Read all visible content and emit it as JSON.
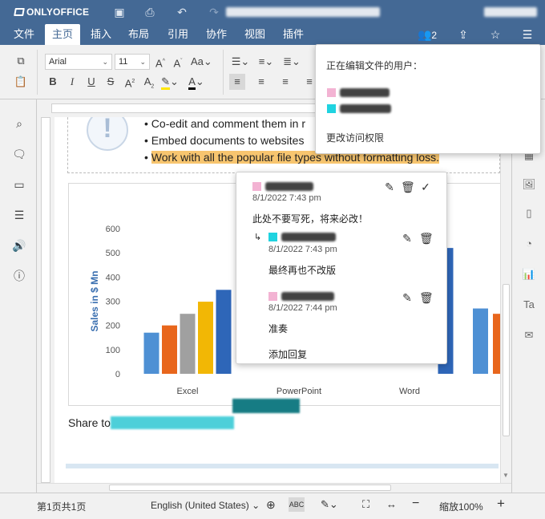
{
  "app": {
    "logo": "ONLYOFFICE"
  },
  "tabs": [
    "文件",
    "主页",
    "插入",
    "布局",
    "引用",
    "协作",
    "视图",
    "插件"
  ],
  "active_tab": "主页",
  "header_right": {
    "users_count": "2"
  },
  "toolbar": {
    "font_name": "Arial",
    "font_size": "11"
  },
  "document": {
    "bullets": [
      "Co-edit and comment them in r",
      "Embed documents to websites",
      "Work with all the popular file types without formatting loss."
    ],
    "share_label": "Share to"
  },
  "chart_data": {
    "type": "bar",
    "ylabel": "Sales in $ Mn",
    "ylim": [
      0,
      600
    ],
    "yticks": [
      "0",
      "100",
      "200",
      "300",
      "400",
      "500",
      "600"
    ],
    "categories": [
      "Excel",
      "PowerPoint",
      "Word"
    ],
    "series": [
      {
        "color": "#4e90d4",
        "values": [
          170,
          null,
          null
        ]
      },
      {
        "color": "#e8661c",
        "values": [
          200,
          null,
          null
        ]
      },
      {
        "color": "#a0a0a0",
        "values": [
          248,
          null,
          null
        ]
      },
      {
        "color": "#f2b705",
        "values": [
          298,
          null,
          null
        ]
      },
      {
        "color": "#2e66b8",
        "values": [
          347,
          null,
          520
        ]
      }
    ],
    "extra_bars_right": [
      {
        "color": "#4e90d4",
        "value": 270
      },
      {
        "color": "#e8661c",
        "value": 248
      }
    ]
  },
  "users_panel": {
    "title": "正在编辑文件的用户：",
    "users": [
      {
        "color": "#f3b3d3"
      },
      {
        "color": "#1fd3e0"
      }
    ],
    "link": "更改访问权限"
  },
  "comment": {
    "author_color": "#f3b3d3",
    "date": "8/1/2022 7:43 pm",
    "text": "此处不要写死，将来必改！",
    "replies": [
      {
        "author_color": "#1fd3e0",
        "date": "8/1/2022 7:43 pm",
        "text": "最终再也不改版"
      },
      {
        "author_color": "#f3b3d3",
        "date": "8/1/2022 7:44 pm",
        "text": "准奏"
      }
    ],
    "add_reply": "添加回复"
  },
  "status": {
    "page": "第1页共1页",
    "language": "English (United States)",
    "zoom": "缩放100%"
  }
}
